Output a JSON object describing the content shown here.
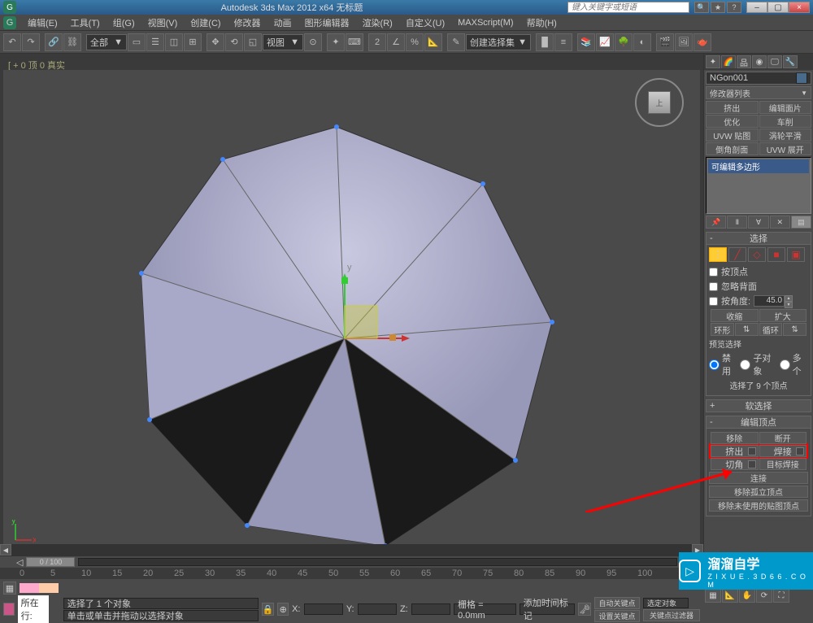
{
  "titlebar": {
    "app_title": "Autodesk 3ds Max 2012 x64   无标题",
    "search_placeholder": "键入关键字或短语"
  },
  "menu": {
    "items": [
      "编辑(E)",
      "工具(T)",
      "组(G)",
      "视图(V)",
      "创建(C)",
      "修改器",
      "动画",
      "图形编辑器",
      "渲染(R)",
      "自定义(U)",
      "MAXScript(M)",
      "帮助(H)"
    ]
  },
  "toolbar": {
    "selection_filter": "全部",
    "view_label": "视图",
    "create_set": "创建选择集"
  },
  "viewport": {
    "label": "[ + 0 顶 0 真实"
  },
  "viewcube": {
    "face": "上"
  },
  "rightpanel": {
    "object_name": "NGon001",
    "modifier_list": "修改器列表",
    "mod_buttons": [
      [
        "挤出",
        "编辑面片"
      ],
      [
        "优化",
        "车削"
      ],
      [
        "UVW 贴图",
        "涡轮平滑"
      ],
      [
        "倒角剖面",
        "UVW 展开"
      ]
    ],
    "stack_item": "可编辑多边形",
    "rollouts": {
      "selection": {
        "title": "选择",
        "by_vertex": "按顶点",
        "ignore_backfacing": "忽略背面",
        "by_angle": "按角度:",
        "angle_value": "45.0",
        "shrink": "收缩",
        "grow": "扩大",
        "ring": "环形",
        "loop": "循环",
        "preview_label": "预览选择",
        "disable": "禁用",
        "subobj": "子对象",
        "multi": "多个",
        "status": "选择了 9 个顶点"
      },
      "soft_selection": {
        "title": "软选择"
      },
      "edit_vertices": {
        "title": "编辑顶点",
        "remove": "移除",
        "break": "断开",
        "extrude": "挤出",
        "weld": "焊接",
        "chamfer": "切角",
        "target_weld": "目标焊接",
        "connect": "连接",
        "remove_isolated": "移除孤立顶点",
        "remove_unused": "移除未使用的贴图顶点"
      }
    }
  },
  "timeline": {
    "slider_value": "0 / 100",
    "ticks": [
      "0",
      "5",
      "10",
      "15",
      "20",
      "25",
      "30",
      "35",
      "40",
      "45",
      "50",
      "55",
      "60",
      "65",
      "70",
      "75",
      "80",
      "85",
      "90",
      "95",
      "100"
    ]
  },
  "status": {
    "selected": "选择了 1 个对象",
    "hint": "单击或单击并拖动以选择对象",
    "x_label": "X:",
    "y_label": "Y:",
    "z_label": "Z:",
    "grid": "栅格 = 0.0mm",
    "location_label": "所在行:",
    "add_time_tag": "添加时间标记",
    "auto_key": "自动关键点",
    "selected_filter": "选定对象",
    "set_key": "设置关键点",
    "key_filter": "关键点过滤器"
  },
  "watermark": {
    "title": "溜溜自学",
    "url": "Z I X U E . 3 D 6 6 . C O M"
  }
}
